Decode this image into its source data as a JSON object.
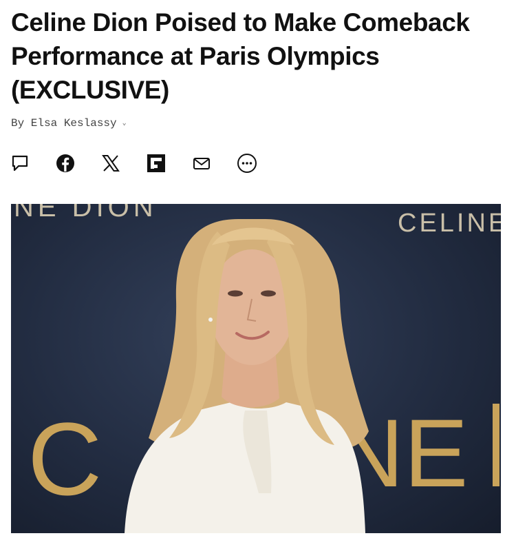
{
  "article": {
    "headline_lines": [
      "Celine Dion Poised to Make Comeback",
      "Performance at Paris Olympics",
      "(EXCLUSIVE)"
    ],
    "byline": "By Elsa Keslassy",
    "byline_chevron": "⌄"
  },
  "share": {
    "icons": [
      "comment-icon",
      "facebook-icon",
      "x-icon",
      "flipboard-icon",
      "email-icon",
      "more-icon"
    ]
  },
  "photo": {
    "backdrop_text_top_left": "NE DION",
    "backdrop_text_top_right": "CELINE",
    "backdrop_letter_left": "C",
    "backdrop_letters_right": "NE",
    "colors": {
      "backdrop": "#232c42",
      "gold": "#c9a35a",
      "hair": "#d8b680",
      "skin": "#e2b597",
      "blouse": "#f4f1ea"
    }
  }
}
